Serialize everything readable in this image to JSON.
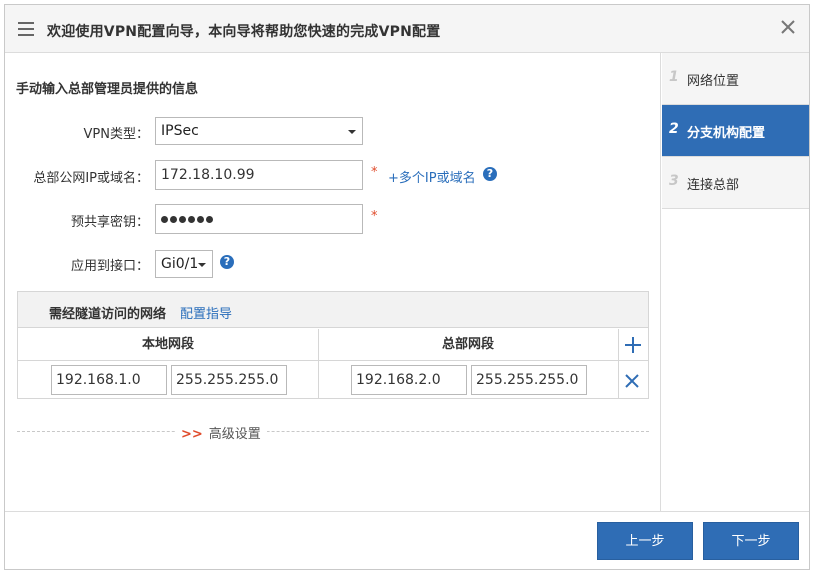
{
  "header": {
    "title": "欢迎使用VPN配置向导，本向导将帮助您快速的完成VPN配置"
  },
  "form": {
    "section_title": "手动输入总部管理员提供的信息",
    "vpn_type_label": "VPN类型：",
    "vpn_type_value": "IPSec",
    "hq_ip_label": "总部公网IP或域名：",
    "hq_ip_value": "172.18.10.99",
    "hq_ip_required": "*",
    "hq_ip_more_link": "+多个IP或域名",
    "psk_label": "预共享密钥：",
    "psk_masked_length": 6,
    "psk_required": "*",
    "iface_label": "应用到接口：",
    "iface_value": "Gi0/1",
    "help_glyph": "?"
  },
  "tunnel": {
    "title": "需经隧道访问的网络",
    "guide_link": "配置指导",
    "columns": [
      "本地网段",
      "总部网段"
    ],
    "rows": [
      {
        "local_ip": "192.168.1.0",
        "local_mask": "255.255.255.0",
        "hq_ip": "192.168.2.0",
        "hq_mask": "255.255.255.0"
      }
    ]
  },
  "advanced": {
    "arrows": ">>",
    "label": "高级设置"
  },
  "steps": [
    {
      "num": "1",
      "label": "网络位置",
      "active": false
    },
    {
      "num": "2",
      "label": "分支机构配置",
      "active": true
    },
    {
      "num": "3",
      "label": "连接总部",
      "active": false
    }
  ],
  "footer": {
    "prev_label": "上一步",
    "next_label": "下一步"
  },
  "colors": {
    "accent": "#2f6db5",
    "required": "#e04b2b",
    "link": "#2a6ebb"
  }
}
